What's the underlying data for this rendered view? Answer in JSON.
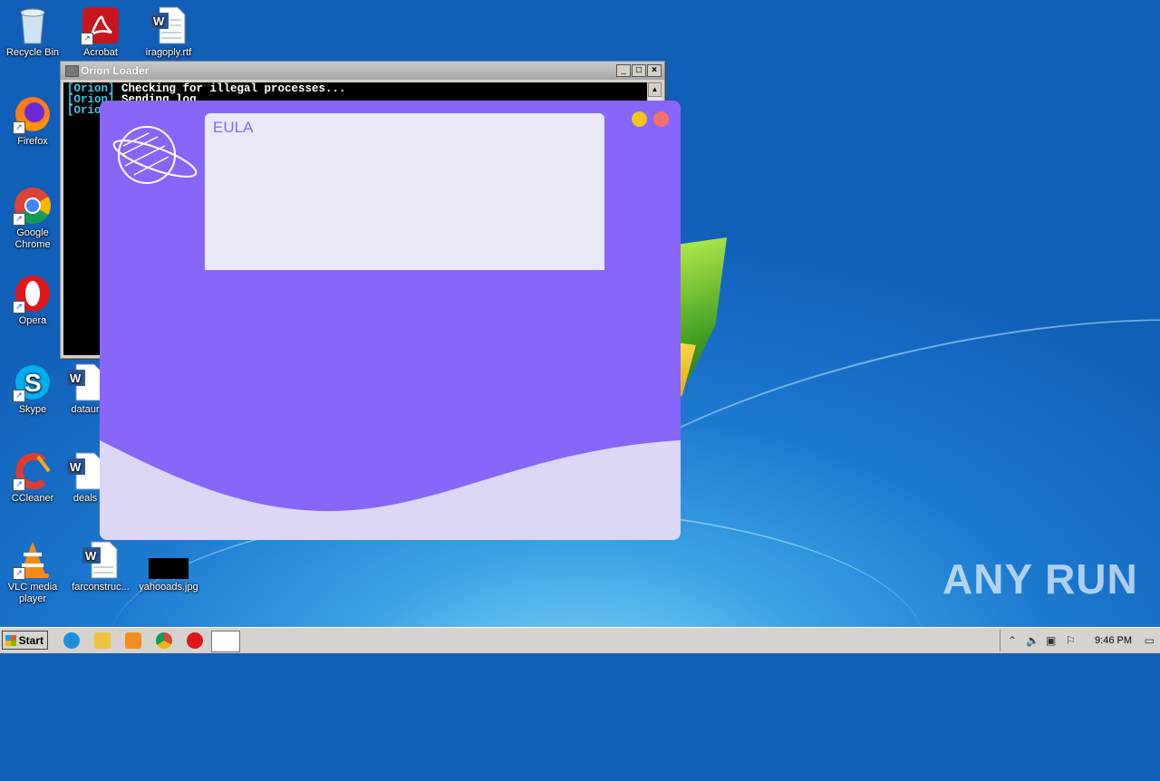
{
  "desktop": {
    "icons": [
      {
        "label": "Recycle Bin",
        "icon": "recycle-bin-icon"
      },
      {
        "label": "Acrobat",
        "icon": "acrobat-icon"
      },
      {
        "label": "iragoply.rtf",
        "icon": "word-doc-icon"
      },
      {
        "label": "Firefox",
        "icon": "firefox-icon"
      },
      {
        "label": "Google Chrome",
        "icon": "chrome-icon"
      },
      {
        "label": "Opera",
        "icon": "opera-icon"
      },
      {
        "label": "Skype",
        "icon": "skype-icon"
      },
      {
        "label": "dataur",
        "icon": "word-doc-icon"
      },
      {
        "label": "CCleaner",
        "icon": "ccleaner-icon"
      },
      {
        "label": "deals",
        "icon": "word-doc-icon"
      },
      {
        "label": "VLC media player",
        "icon": "vlc-icon"
      },
      {
        "label": "farconstruc...",
        "icon": "word-doc-icon"
      },
      {
        "label": "yahooads.jpg",
        "icon": "image-file-icon"
      }
    ]
  },
  "console": {
    "title": "Orion Loader",
    "lines": [
      {
        "tag": "[Orion]",
        "text": " Checking for illegal processes..."
      },
      {
        "tag": "[Orion]",
        "text": " Sending log..."
      },
      {
        "tag": "[Orio",
        "text": ""
      }
    ]
  },
  "eula": {
    "label": "EULA",
    "colors": {
      "background": "#8866fa",
      "textbox": "#e8e8f8",
      "wave": "#dcd6f7",
      "minimize": "#f5c518",
      "close": "#f2736e"
    }
  },
  "taskbar": {
    "start_label": "Start",
    "clock": "9:46 PM"
  },
  "watermark": "ANY RUN"
}
